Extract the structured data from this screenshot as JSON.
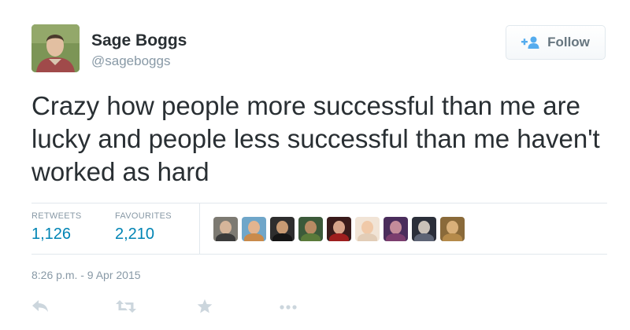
{
  "user": {
    "display_name": "Sage Boggs",
    "handle": "@sageboggs"
  },
  "follow_button": {
    "label": "Follow",
    "icon": "follow-person-plus-icon"
  },
  "tweet": {
    "text": "Crazy how people more successful than me are lucky and people less successful than me haven't worked as hard"
  },
  "stats": {
    "retweets_label": "RETWEETS",
    "retweets_count": "1,126",
    "favourites_label": "FAVOURITES",
    "favourites_count": "2,210"
  },
  "timestamp": "8:26 p.m. - 9 Apr 2015",
  "actions": [
    {
      "name": "reply",
      "icon": "reply-icon"
    },
    {
      "name": "retweet",
      "icon": "retweet-icon"
    },
    {
      "name": "favourite",
      "icon": "star-icon"
    },
    {
      "name": "more",
      "icon": "more-dots-icon"
    }
  ],
  "colors": {
    "link_blue": "#0084b4",
    "follow_blue": "#55acee",
    "muted_gray": "#8899a6",
    "action_gray": "#ccd6dd",
    "text": "#292f33"
  }
}
